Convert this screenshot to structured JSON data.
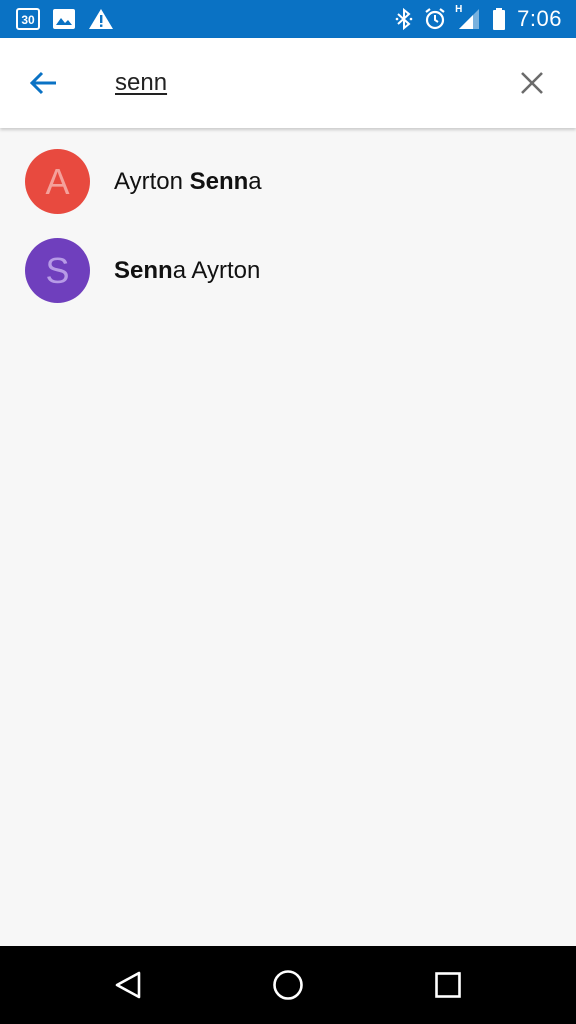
{
  "status_bar": {
    "calendar_day": "30",
    "network_type": "H",
    "time": "7:06",
    "background": "#0a72c4",
    "icons_left": [
      "calendar-icon",
      "image-icon",
      "warning-icon"
    ],
    "icons_right": [
      "bluetooth-icon",
      "alarm-icon",
      "signal-icon",
      "battery-icon"
    ]
  },
  "search": {
    "query": "senn",
    "back_icon": "arrow-left-icon",
    "clear_icon": "close-icon",
    "accent": "#0a72c4"
  },
  "results": [
    {
      "initial": "A",
      "avatar_color": "#e84a3f",
      "initial_color": "#f4a19b",
      "name_before": "Ayrton ",
      "name_match": "Senn",
      "name_after": "a"
    },
    {
      "initial": "S",
      "avatar_color": "#6f3fbd",
      "initial_color": "#b79be6",
      "name_before": "",
      "name_match": "Senn",
      "name_after": "a Ayrton"
    }
  ],
  "nav_bar": {
    "icons": [
      "back-triangle-icon",
      "home-circle-icon",
      "recents-square-icon"
    ]
  }
}
